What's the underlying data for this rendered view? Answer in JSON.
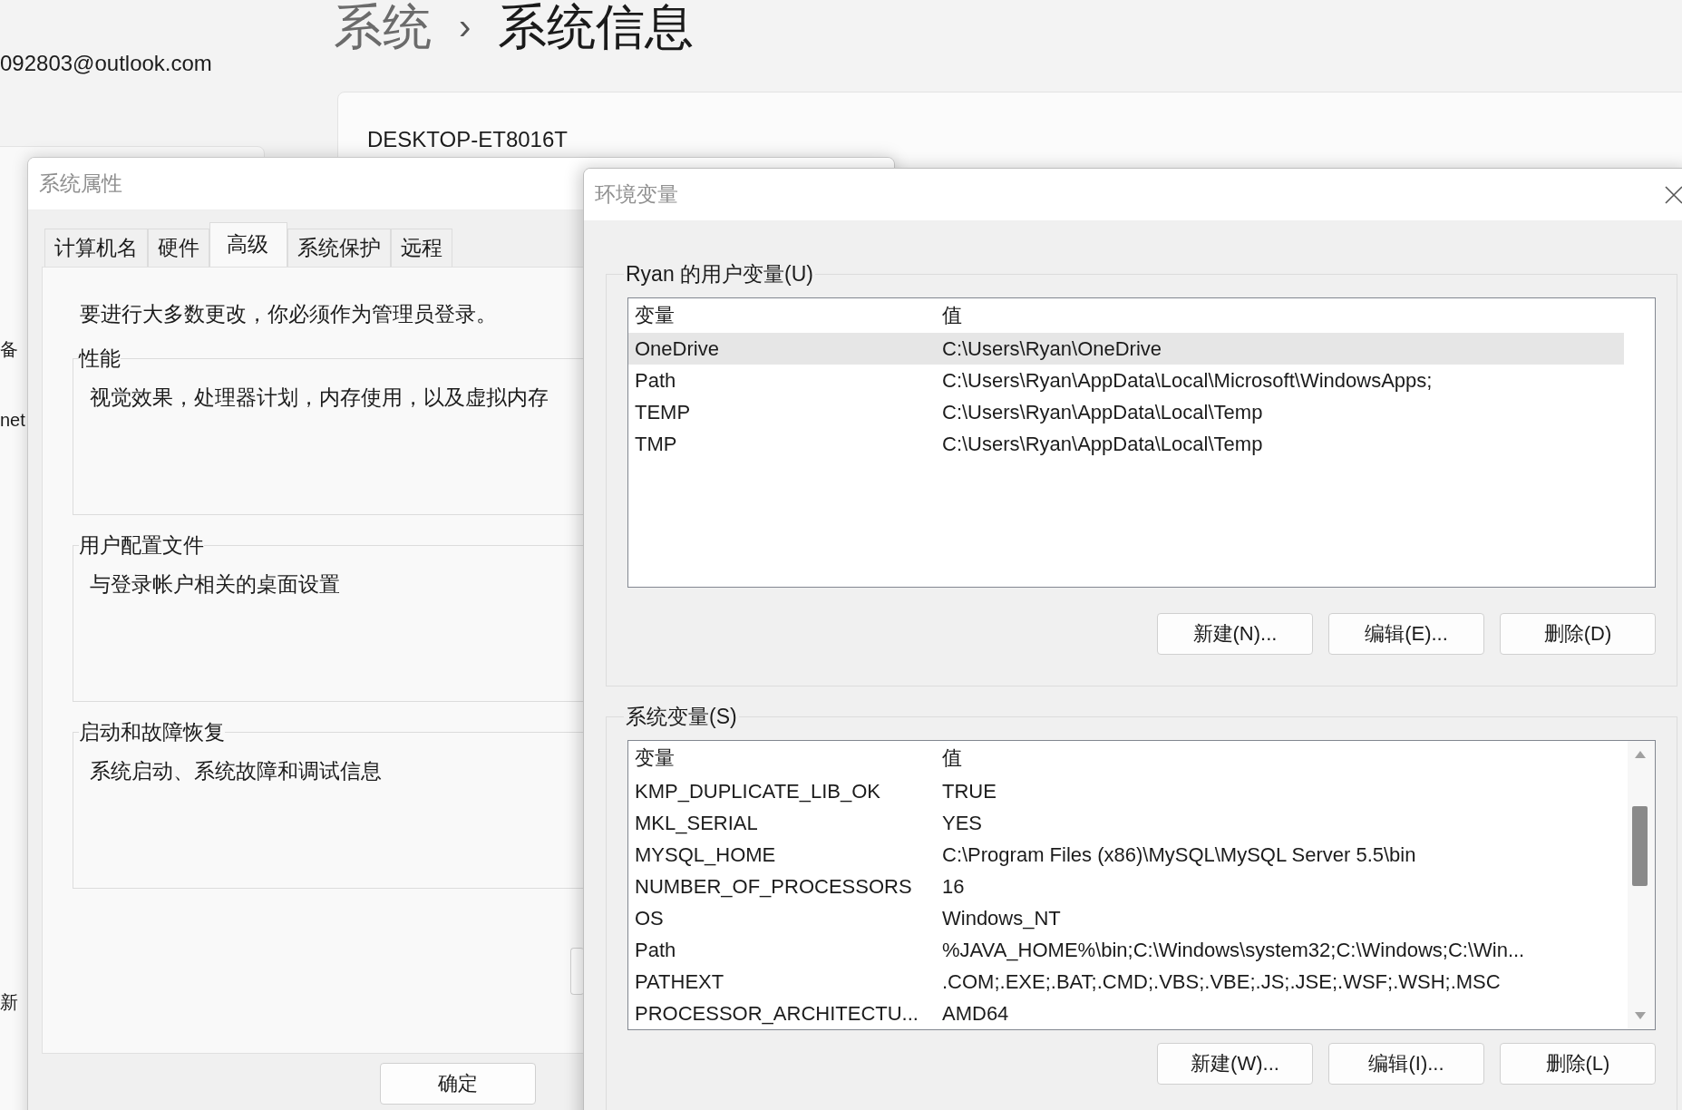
{
  "background": {
    "breadcrumb": [
      "系统",
      "系统信息"
    ],
    "breadcrumb_separator": "›",
    "account_email": "092803@outlook.com",
    "device_name": "DESKTOP-ET8016T",
    "sidebar_fragments": [
      "备",
      "net",
      "新"
    ]
  },
  "system_properties": {
    "title": "系统属性",
    "tabs": [
      {
        "label": "计算机名",
        "selected": false
      },
      {
        "label": "硬件",
        "selected": false
      },
      {
        "label": "高级",
        "selected": true
      },
      {
        "label": "系统保护",
        "selected": false
      },
      {
        "label": "远程",
        "selected": false
      }
    ],
    "admin_note": "要进行大多数更改，你必须作为管理员登录。",
    "groups": [
      {
        "title": "性能",
        "description": "视觉效果，处理器计划，内存使用，以及虚拟内存"
      },
      {
        "title": "用户配置文件",
        "description": "与登录帐户相关的桌面设置"
      },
      {
        "title": "启动和故障恢复",
        "description": "系统启动、系统故障和调试信息"
      }
    ],
    "buttons": [
      "确定"
    ]
  },
  "environment_variables": {
    "title": "环境变量",
    "user_variables": {
      "title": "Ryan 的用户变量(U)",
      "columns": [
        "变量",
        "值"
      ],
      "rows": [
        {
          "name": "OneDrive",
          "value": "C:\\Users\\Ryan\\OneDrive",
          "selected": true
        },
        {
          "name": "Path",
          "value": "C:\\Users\\Ryan\\AppData\\Local\\Microsoft\\WindowsApps;",
          "selected": false
        },
        {
          "name": "TEMP",
          "value": "C:\\Users\\Ryan\\AppData\\Local\\Temp",
          "selected": false
        },
        {
          "name": "TMP",
          "value": "C:\\Users\\Ryan\\AppData\\Local\\Temp",
          "selected": false
        }
      ],
      "buttons": [
        "新建(N)...",
        "编辑(E)...",
        "删除(D)"
      ]
    },
    "system_variables": {
      "title": "系统变量(S)",
      "columns": [
        "变量",
        "值"
      ],
      "rows": [
        {
          "name": "KMP_DUPLICATE_LIB_OK",
          "value": "TRUE",
          "selected": false
        },
        {
          "name": "MKL_SERIAL",
          "value": "YES",
          "selected": false
        },
        {
          "name": "MYSQL_HOME",
          "value": "C:\\Program Files (x86)\\MySQL\\MySQL Server 5.5\\bin",
          "selected": false
        },
        {
          "name": "NUMBER_OF_PROCESSORS",
          "value": "16",
          "selected": false
        },
        {
          "name": "OS",
          "value": "Windows_NT",
          "selected": false
        },
        {
          "name": "Path",
          "value": "%JAVA_HOME%\\bin;C:\\Windows\\system32;C:\\Windows;C:\\Win...",
          "selected": false
        },
        {
          "name": "PATHEXT",
          "value": ".COM;.EXE;.BAT;.CMD;.VBS;.VBE;.JS;.JSE;.WSF;.WSH;.MSC",
          "selected": false
        },
        {
          "name": "PROCESSOR_ARCHITECTU...",
          "value": "AMD64",
          "selected": false
        }
      ],
      "buttons": [
        "新建(W)...",
        "编辑(I)...",
        "删除(L)"
      ]
    }
  }
}
